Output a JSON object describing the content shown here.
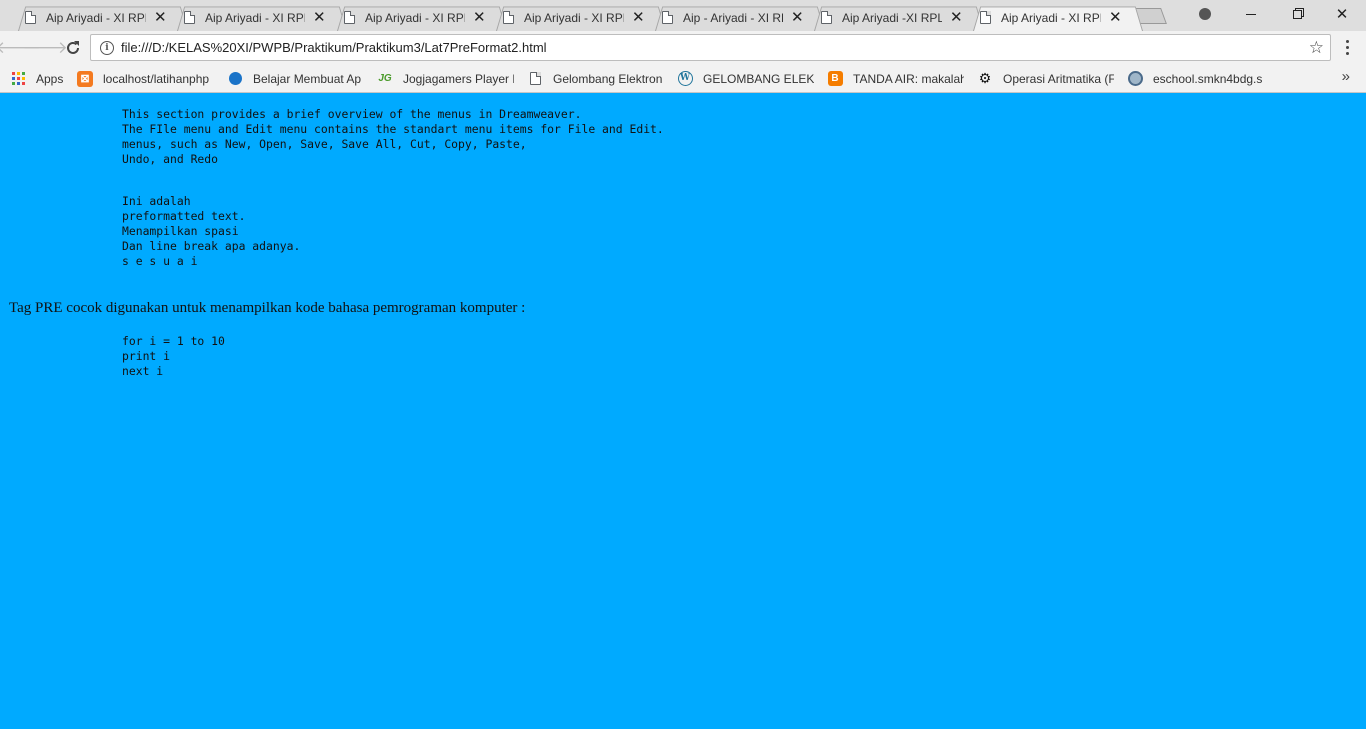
{
  "tabs": [
    {
      "title": "Aip Ariyadi - XI RPL"
    },
    {
      "title": "Aip Ariyadi - XI RPL"
    },
    {
      "title": "Aip Ariyadi - XI RPL"
    },
    {
      "title": "Aip Ariyadi - XI RPL"
    },
    {
      "title": "Aip - Ariyadi - XI RPL"
    },
    {
      "title": "Aip Ariyadi -XI RPL"
    },
    {
      "title": "Aip Ariyadi - XI RPL"
    }
  ],
  "active_tab_index": 6,
  "address_bar": {
    "url": "file:///D:/KELAS%20XI/PWPB/Praktikum/Praktikum3/Lat7PreFormat2.html"
  },
  "bookmarks": [
    {
      "label": "Apps",
      "icon": "apps-grid-icon"
    },
    {
      "label": "localhost/latihanphp",
      "icon": "xampp-icon"
    },
    {
      "label": "Belajar Membuat Ap",
      "icon": "blue-drop-icon"
    },
    {
      "label": "Jogjagamers Player F",
      "icon": "jg-icon"
    },
    {
      "label": "Gelombang Elektron",
      "icon": "page-icon"
    },
    {
      "label": "GELOMBANG ELEKTR",
      "icon": "wordpress-icon"
    },
    {
      "label": "TANDA AIR: makalah",
      "icon": "blogger-icon"
    },
    {
      "label": "Operasi Aritmatika (F",
      "icon": "gears-icon"
    },
    {
      "label": "eschool.smkn4bdg.s",
      "icon": "school-icon"
    }
  ],
  "content": {
    "pre1": "This section provides a brief overview of the menus in Dreamweaver.\nThe FIle menu and Edit menu contains the standart menu items for File and Edit.\nmenus, such as New, Open, Save, Save All, Cut, Copy, Paste,\nUndo, and Redo",
    "pre2": "Ini adalah\npreformatted text.\nMenampilkan spasi\nDan line break apa adanya.\ns e s u a i",
    "paragraph": "Tag PRE cocok digunakan untuk menampilkan kode bahasa pemrograman komputer :",
    "pre3": "for i = 1 to 10\nprint i\nnext i"
  },
  "colors": {
    "page_background": "#00aaff",
    "chrome_background": "#f2f2f2"
  }
}
